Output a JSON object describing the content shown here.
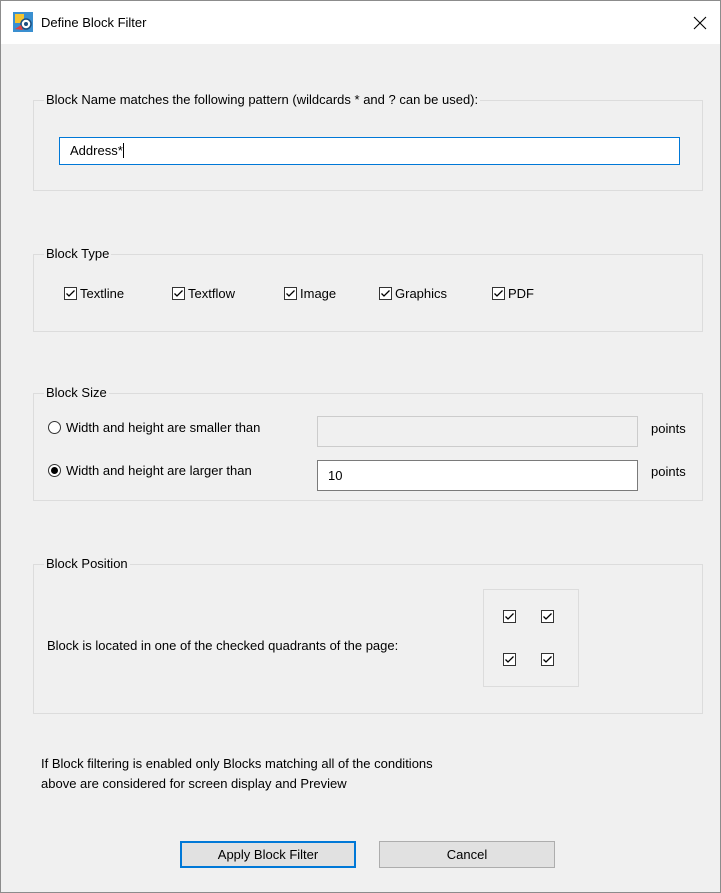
{
  "window": {
    "title": "Define Block Filter"
  },
  "name_group": {
    "legend": "Block Name matches the following pattern (wildcards * and ? can be used):",
    "pattern_value": "Address*"
  },
  "type_group": {
    "legend": "Block Type",
    "types": [
      {
        "label": "Textline",
        "checked": true
      },
      {
        "label": "Textflow",
        "checked": true
      },
      {
        "label": "Image",
        "checked": true
      },
      {
        "label": "Graphics",
        "checked": true
      },
      {
        "label": "PDF",
        "checked": true
      }
    ]
  },
  "size_group": {
    "legend": "Block Size",
    "smaller_label": "Width and height are smaller than",
    "smaller_value": "",
    "larger_label": "Width and height are larger than",
    "larger_value": "10",
    "unit": "points",
    "selected": "larger"
  },
  "position_group": {
    "legend": "Block Position",
    "label": "Block is located in one of the checked quadrants of the page:",
    "quadrants": {
      "top_left": true,
      "top_right": true,
      "bottom_left": true,
      "bottom_right": true
    }
  },
  "info_text": {
    "line1": "If Block filtering is enabled only Blocks matching all of the conditions",
    "line2": "above are considered for screen display and Preview"
  },
  "buttons": {
    "apply": "Apply Block Filter",
    "cancel": "Cancel"
  },
  "icons": {
    "app": "block-filter-app-icon",
    "close": "close-icon",
    "check": "checkmark-icon"
  }
}
